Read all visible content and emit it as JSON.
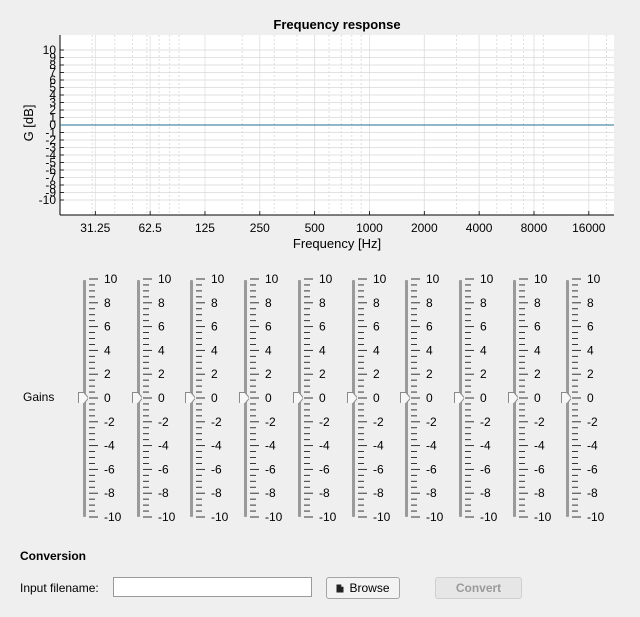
{
  "chart_data": {
    "type": "line",
    "title": "Frequency response",
    "xlabel": "Frequency [Hz]",
    "ylabel": "G [dB]",
    "x_scale": "log",
    "xlim": [
      20,
      22000
    ],
    "ylim": [
      -12,
      12
    ],
    "x_ticks": [
      31.25,
      62.5,
      125,
      250,
      500,
      1000,
      2000,
      4000,
      8000,
      16000
    ],
    "x_tick_labels": [
      "31.25",
      "62.5",
      "125",
      "250",
      "500",
      "1000",
      "2000",
      "4000",
      "8000",
      "16000"
    ],
    "y_ticks": [
      10,
      9,
      8,
      7,
      6,
      5,
      4,
      3,
      2,
      1,
      0,
      -1,
      -2,
      -3,
      -4,
      -5,
      -6,
      -7,
      -8,
      -9,
      -10
    ],
    "y_tick_labels": [
      "10",
      "9",
      "8",
      "7",
      "6",
      "5",
      "4",
      "3",
      "2",
      "1",
      "0",
      "-1",
      "-2",
      "-3",
      "-4",
      "-5",
      "-6",
      "-7",
      "-8",
      "-9",
      "-10"
    ],
    "grid": true,
    "series": [
      {
        "x": [
          20,
          22000
        ],
        "y": [
          0,
          0
        ],
        "color": "#1f6f8b"
      }
    ]
  },
  "gains": {
    "label": "Gains",
    "scale_labels": [
      "10",
      "8",
      "6",
      "4",
      "2",
      "0",
      "-2",
      "-4",
      "-6",
      "-8",
      "-10"
    ],
    "min": -10,
    "max": 10,
    "bands": [
      {
        "value": 0
      },
      {
        "value": 0
      },
      {
        "value": 0
      },
      {
        "value": 0
      },
      {
        "value": 0
      },
      {
        "value": 0
      },
      {
        "value": 0
      },
      {
        "value": 0
      },
      {
        "value": 0
      },
      {
        "value": 0
      }
    ]
  },
  "conversion": {
    "title": "Conversion",
    "input_label": "Input filename:",
    "input_value": "",
    "browse_label": "Browse",
    "browse_icon": "document-icon",
    "convert_label": "Convert",
    "convert_enabled": false
  }
}
